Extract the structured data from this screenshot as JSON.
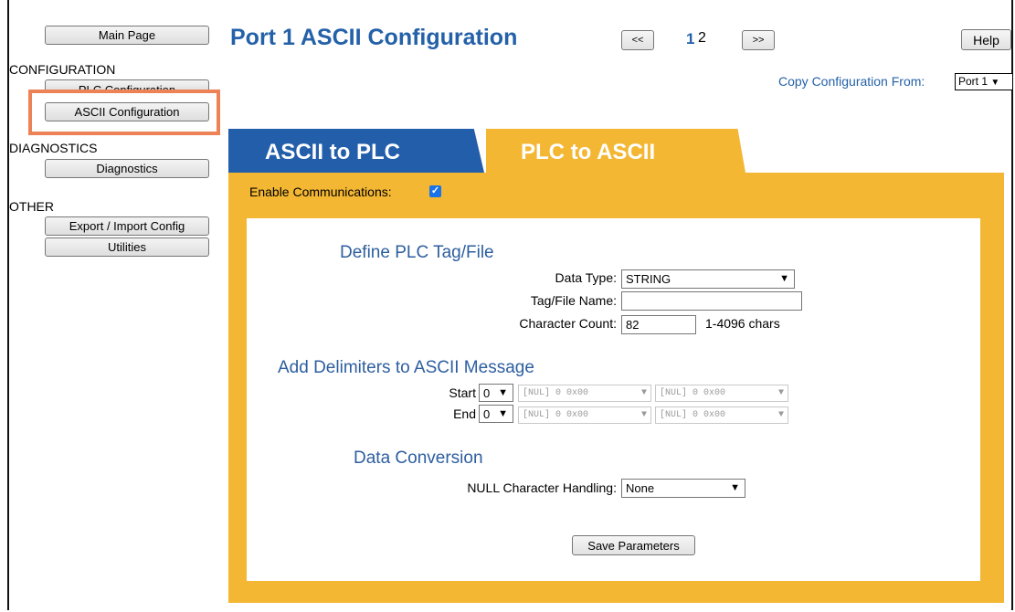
{
  "sidebar": {
    "main_page": "Main Page",
    "configuration_heading": "CONFIGURATION",
    "plc_configuration": "PLC Configuration",
    "ascii_configuration": "ASCII Configuration",
    "diagnostics_heading": "DIAGNOSTICS",
    "diagnostics": "Diagnostics",
    "other_heading": "OTHER",
    "export_import": "Export / Import Config",
    "utilities": "Utilities"
  },
  "header": {
    "title": "Port 1 ASCII Configuration",
    "prev": "<<",
    "page_current": "1",
    "page_other": "2",
    "next": ">>",
    "help": "Help",
    "copy_label": "Copy Configuration From:",
    "copy_value": "Port 1"
  },
  "tabs": {
    "ascii_to_plc": "ASCII to PLC",
    "plc_to_ascii": "PLC to ASCII"
  },
  "panel": {
    "enable_label": "Enable Communications:",
    "enable_checked": true,
    "define_title": "Define PLC Tag/File",
    "data_type_label": "Data Type:",
    "data_type_value": "STRING",
    "tag_name_label": "Tag/File Name:",
    "tag_name_value": "",
    "char_count_label": "Character Count:",
    "char_count_value": "82",
    "char_count_hint": "1-4096 chars",
    "delim_title": "Add Delimiters to ASCII Message",
    "start_label": "Start",
    "start_count": "0",
    "end_label": "End",
    "end_count": "0",
    "delim_value": "[NUL]   0 0x00",
    "conversion_title": "Data Conversion",
    "null_label": "NULL Character Handling:",
    "null_value": "None",
    "save": "Save Parameters"
  },
  "colors": {
    "brand_blue": "#2461a8",
    "tab_blue": "#235eaa",
    "tab_gold": "#f3b733",
    "highlight": "#ee8257"
  }
}
